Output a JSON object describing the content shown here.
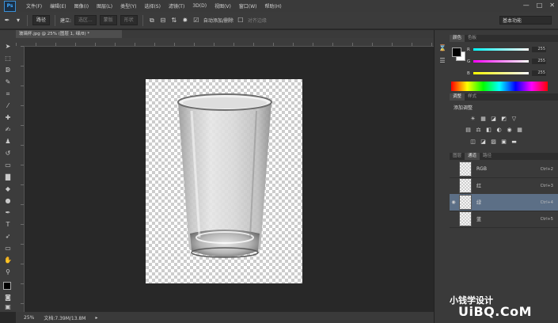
{
  "app": {
    "logo": "Ps"
  },
  "menu": [
    "文件(F)",
    "编辑(E)",
    "图像(I)",
    "图层(L)",
    "类型(Y)",
    "选择(S)",
    "滤镜(T)",
    "3D(D)",
    "视图(V)",
    "窗口(W)",
    "帮助(H)"
  ],
  "window_controls": [
    "—",
    "□",
    "✕"
  ],
  "options_bar": {
    "tool_select": "路径",
    "make_label": "建立:",
    "selection_btn": "选区...",
    "mask_btn": "蒙版",
    "shape_btn": "形状",
    "auto_add_delete": "自动添加/删除",
    "align_edges": "对齐边缘",
    "workspace": "基本功能"
  },
  "document": {
    "tab_title": "玻璃杯.jpg @ 25% (图层 1, 绿/8) *",
    "zoom": "25%",
    "doc_size": "文档:7.39M/13.8M"
  },
  "color_panel": {
    "tabs": [
      "颜色",
      "色板"
    ],
    "channels": [
      {
        "label": "R",
        "value": "255",
        "gradient": "linear-gradient(to right,#00ffff,#ffffff)"
      },
      {
        "label": "G",
        "value": "255",
        "gradient": "linear-gradient(to right,#ff00ff,#ffffff)"
      },
      {
        "label": "B",
        "value": "255",
        "gradient": "linear-gradient(to right,#ffff00,#ffffff)"
      }
    ]
  },
  "adjustments_panel": {
    "tabs": [
      "调整",
      "样式"
    ],
    "title": "添加调整",
    "row1": [
      "☀",
      "▦",
      "◪",
      "◩",
      "▽"
    ],
    "row2": [
      "▤",
      "⚖",
      "◧",
      "◐",
      "◉",
      "▦"
    ],
    "row3": [
      "◫",
      "◪",
      "▨",
      "▣",
      "▬"
    ]
  },
  "channels_panel": {
    "tabs": [
      "图层",
      "通道",
      "路径"
    ],
    "rows": [
      {
        "name": "RGB",
        "shortcut": "Ctrl+2",
        "visible": false,
        "selected": false
      },
      {
        "name": "红",
        "shortcut": "Ctrl+3",
        "visible": false,
        "selected": false
      },
      {
        "name": "绿",
        "shortcut": "Ctrl+4",
        "visible": true,
        "selected": true
      },
      {
        "name": "蓝",
        "shortcut": "Ctrl+5",
        "visible": false,
        "selected": false
      }
    ]
  },
  "watermark": {
    "line1": "小钱学设计",
    "line2": "UiBQ.CoM"
  },
  "colors": {
    "accent_selected": "#5c6f86",
    "panel_bg": "#3a3a3a",
    "canvas_bg": "#282828",
    "ps_blue": "#3fa8ff"
  }
}
